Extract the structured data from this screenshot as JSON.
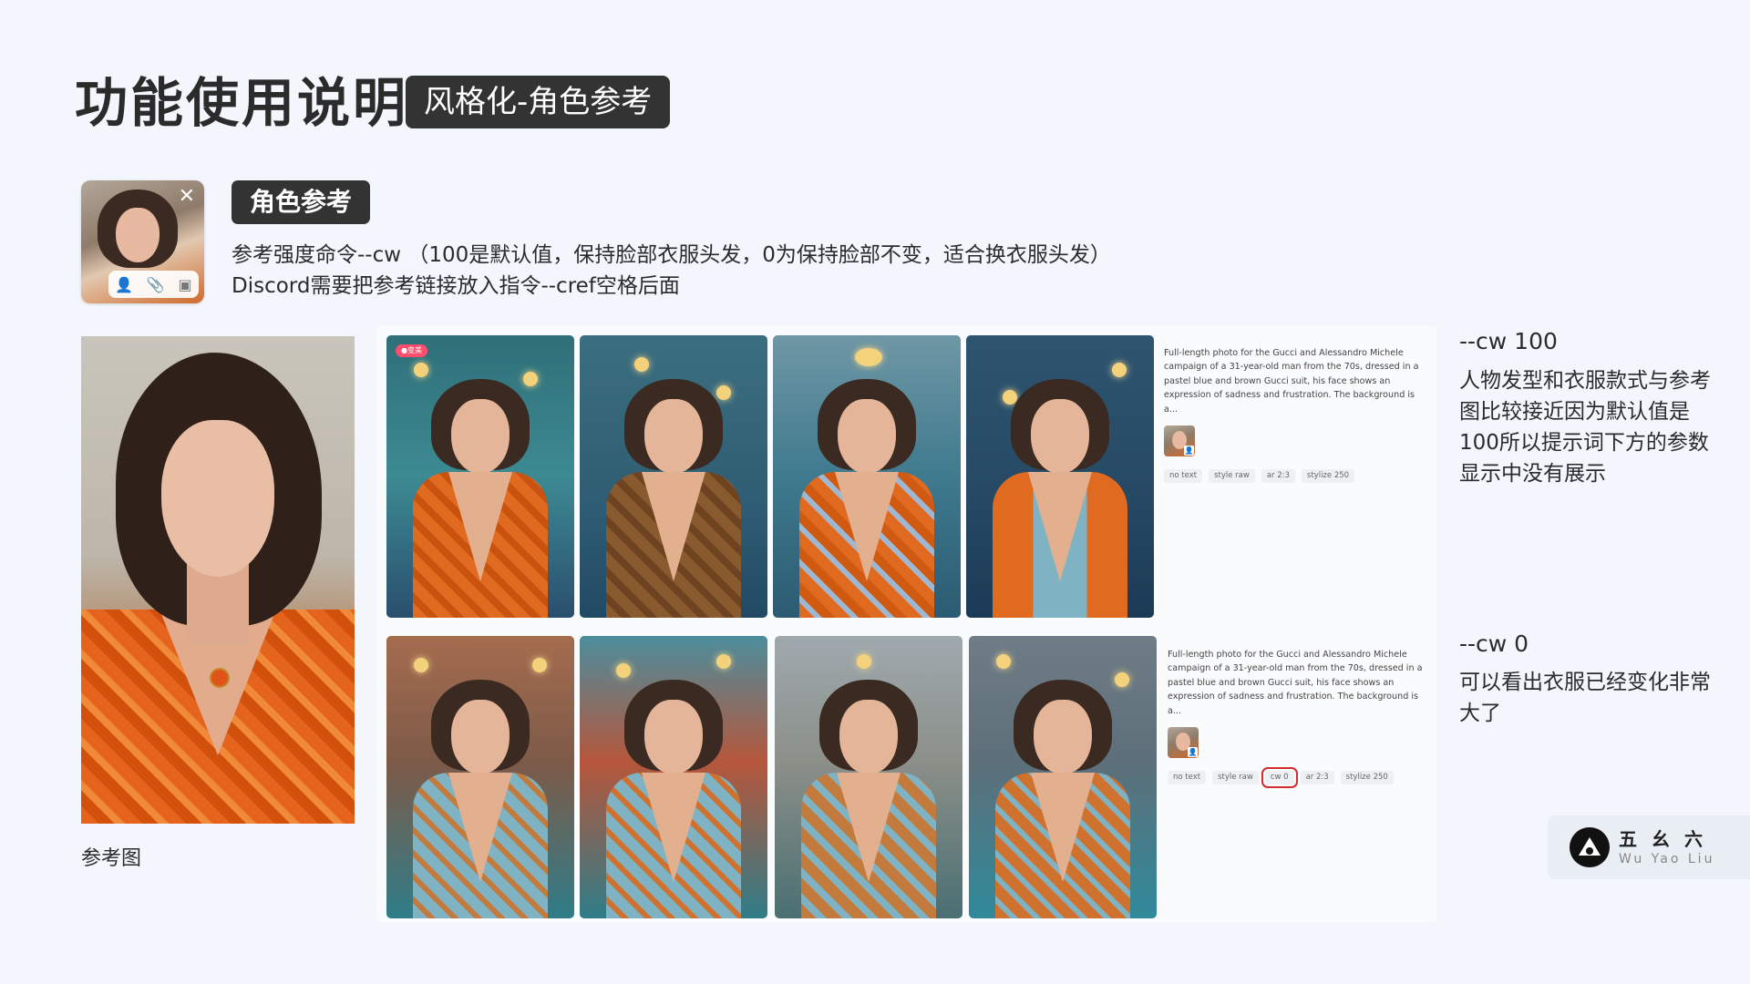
{
  "header": {
    "title": "功能使用说明",
    "tag": "风格化-角色参考"
  },
  "thumb_card": {
    "close_glyph": "✕",
    "icons": [
      "person-icon",
      "paperclip-icon",
      "image-icon"
    ]
  },
  "section": {
    "tag": "角色参考",
    "line1": "参考强度命令--cw （100是默认值，保持脸部衣服头发，0为保持脸部不变，适合换衣服头发）",
    "line2": "Discord需要把参考链接放入指令--cref空格后面"
  },
  "reference": {
    "caption": "参考图"
  },
  "rows": [
    {
      "badge": "●变美",
      "prompt": "Full-length photo for the Gucci and Alessandro Michele campaign of a 31-year-old man from the 70s, dressed in a pastel blue and brown Gucci suit, his face shows an expression of sadness and frustration. The background is a...",
      "chips": [
        {
          "label": "no text",
          "highlight": false
        },
        {
          "label": "style raw",
          "highlight": false
        },
        {
          "label": "ar 2:3",
          "highlight": false
        },
        {
          "label": "stylize 250",
          "highlight": false
        }
      ],
      "note_head": "--cw 100",
      "note_body": "人物发型和衣服款式与参考图比较接近因为默认值是100所以提示词下方的参数显示中没有展示"
    },
    {
      "badge": "",
      "prompt": "Full-length photo for the Gucci and Alessandro Michele campaign of a 31-year-old man from the 70s, dressed in a pastel blue and brown Gucci suit, his face shows an expression of sadness and frustration. The background is a...",
      "chips": [
        {
          "label": "no text",
          "highlight": false
        },
        {
          "label": "style raw",
          "highlight": false
        },
        {
          "label": "cw 0",
          "highlight": true
        },
        {
          "label": "ar 2:3",
          "highlight": false
        },
        {
          "label": "stylize 250",
          "highlight": false
        }
      ],
      "note_head": "--cw 0",
      "note_body": "可以看出衣服已经变化非常大了"
    }
  ],
  "logo": {
    "cn": "五幺六",
    "en": "Wu Yao Liu"
  },
  "colors": {
    "background": "#f3f6fc",
    "tag_bg": "#333333",
    "highlight": "#d42b2b",
    "jacket_orange": "#e06a20",
    "jacket_blue": "#7fb3c4"
  }
}
